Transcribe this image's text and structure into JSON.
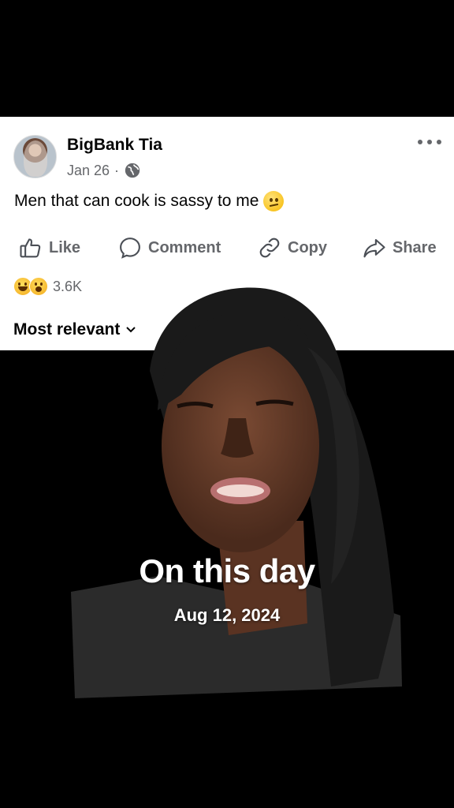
{
  "post": {
    "author": "BigBank Tia",
    "date": "Jan 26",
    "dot": "·",
    "text": "Men that can cook is sassy to me",
    "text_emoji": "confused-face",
    "actions": [
      {
        "label": "Like",
        "icon": "thumbs-up-icon"
      },
      {
        "label": "Comment",
        "icon": "comment-bubble-icon"
      },
      {
        "label": "Copy",
        "icon": "link-icon"
      },
      {
        "label": "Share",
        "icon": "share-arrow-icon"
      }
    ],
    "reactions": {
      "icons": [
        "laughing-face",
        "surprised-face"
      ],
      "count": "3.6K"
    },
    "sort_label": "Most relevant"
  },
  "overlay": {
    "title": "On this day",
    "date": "Aug 12, 2024"
  },
  "colors": {
    "background": "#000000",
    "card": "#ffffff",
    "text_primary": "#050505",
    "text_secondary": "#65676b"
  }
}
